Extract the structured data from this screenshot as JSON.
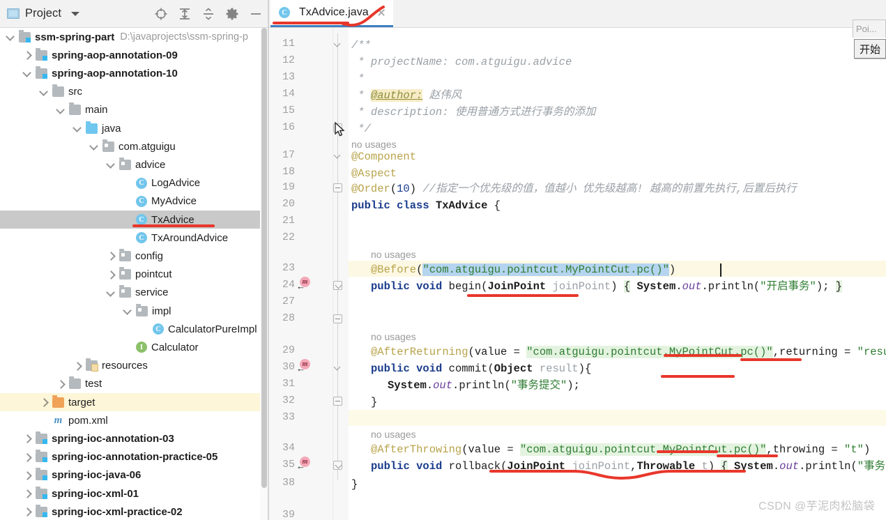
{
  "project_panel": {
    "title": "Project",
    "dropdown_icon": "chevron-down-icon",
    "toolbar_icons": [
      "locate-target-icon",
      "expand-all-icon",
      "collapse-all-icon",
      "settings-gear-icon",
      "minimize-icon"
    ],
    "tree": [
      {
        "label": "ssm-spring-part",
        "path": "D:\\javaprojects\\ssm-spring-p",
        "indent": 0,
        "arrow": "down",
        "icon": "module-folder",
        "bold": true
      },
      {
        "label": "spring-aop-annotation-09",
        "path": "",
        "indent": 1,
        "arrow": "right",
        "icon": "module-folder",
        "bold": true
      },
      {
        "label": "spring-aop-annotation-10",
        "path": "",
        "indent": 1,
        "arrow": "down",
        "icon": "module-folder",
        "bold": true
      },
      {
        "label": "src",
        "path": "",
        "indent": 2,
        "arrow": "down",
        "icon": "folder",
        "bold": false
      },
      {
        "label": "main",
        "path": "",
        "indent": 3,
        "arrow": "down",
        "icon": "folder",
        "bold": false
      },
      {
        "label": "java",
        "path": "",
        "indent": 4,
        "arrow": "down",
        "icon": "source-folder",
        "bold": false
      },
      {
        "label": "com.atguigu",
        "path": "",
        "indent": 5,
        "arrow": "down",
        "icon": "package",
        "bold": false
      },
      {
        "label": "advice",
        "path": "",
        "indent": 6,
        "arrow": "down",
        "icon": "package",
        "bold": false
      },
      {
        "label": "LogAdvice",
        "path": "",
        "indent": 7,
        "arrow": "none",
        "icon": "java-class",
        "bold": false
      },
      {
        "label": "MyAdvice",
        "path": "",
        "indent": 7,
        "arrow": "none",
        "icon": "java-class",
        "bold": false
      },
      {
        "label": "TxAdvice",
        "path": "",
        "indent": 7,
        "arrow": "none",
        "icon": "java-class",
        "bold": false,
        "selected": true
      },
      {
        "label": "TxAroundAdvice",
        "path": "",
        "indent": 7,
        "arrow": "none",
        "icon": "java-class",
        "bold": false
      },
      {
        "label": "config",
        "path": "",
        "indent": 6,
        "arrow": "right",
        "icon": "package",
        "bold": false
      },
      {
        "label": "pointcut",
        "path": "",
        "indent": 6,
        "arrow": "right",
        "icon": "package",
        "bold": false
      },
      {
        "label": "service",
        "path": "",
        "indent": 6,
        "arrow": "down",
        "icon": "package",
        "bold": false
      },
      {
        "label": "impl",
        "path": "",
        "indent": 7,
        "arrow": "down",
        "icon": "package",
        "bold": false
      },
      {
        "label": "CalculatorPureImpl",
        "path": "",
        "indent": 8,
        "arrow": "none",
        "icon": "java-class",
        "bold": false
      },
      {
        "label": "Calculator",
        "path": "",
        "indent": 7,
        "arrow": "none",
        "icon": "java-interface",
        "bold": false
      },
      {
        "label": "resources",
        "path": "",
        "indent": 4,
        "arrow": "right",
        "icon": "resources-folder",
        "bold": false
      },
      {
        "label": "test",
        "path": "",
        "indent": 3,
        "arrow": "right",
        "icon": "folder",
        "bold": false
      },
      {
        "label": "target",
        "path": "",
        "indent": 2,
        "arrow": "right",
        "icon": "excluded-folder",
        "bold": false,
        "highlight": true
      },
      {
        "label": "pom.xml",
        "path": "",
        "indent": 2,
        "arrow": "none",
        "icon": "maven-file",
        "bold": false
      },
      {
        "label": "spring-ioc-annotation-03",
        "path": "",
        "indent": 1,
        "arrow": "right",
        "icon": "module-folder",
        "bold": true
      },
      {
        "label": "spring-ioc-annotation-practice-05",
        "path": "",
        "indent": 1,
        "arrow": "right",
        "icon": "module-folder",
        "bold": true
      },
      {
        "label": "spring-ioc-java-06",
        "path": "",
        "indent": 1,
        "arrow": "right",
        "icon": "module-folder",
        "bold": true
      },
      {
        "label": "spring-ioc-xml-01",
        "path": "",
        "indent": 1,
        "arrow": "right",
        "icon": "module-folder",
        "bold": true
      },
      {
        "label": "spring-ioc-xml-practice-02",
        "path": "",
        "indent": 1,
        "arrow": "right",
        "icon": "module-folder",
        "bold": true
      }
    ]
  },
  "editor": {
    "tab": {
      "label": "TxAdvice.java",
      "icon": "java-class-icon",
      "close_icon": "close-icon"
    },
    "line_numbers": [
      "11",
      "12",
      "13",
      "14",
      "15",
      "16",
      "17",
      "18",
      "19",
      "20",
      "21",
      "22",
      "23",
      "24",
      "27",
      "28",
      "29",
      "30",
      "31",
      "32",
      "33",
      "34",
      "35",
      "38",
      "39"
    ],
    "gutter_marks": [
      "advice-method-marker",
      "advice-method-marker",
      "advice-method-marker"
    ],
    "inlay_no_usages": "no usages",
    "code": {
      "l11": "/**",
      "l12_pre": " * projectName: ",
      "l12_val": "com.atguigu.advice",
      "l13": " *",
      "l14_pre": " * ",
      "l14_tag": "@author:",
      "l14_val": " 赵伟风",
      "l15": " * description: 使用普通方式进行事务的添加",
      "l16": " */",
      "l17": "@Component",
      "l18": "@Aspect",
      "l19_anno": "@Order",
      "l19_num": "10",
      "l19_comment": "//指定一个优先级的值，值越小 优先级越高! 越高的前置先执行,后置后执行",
      "l20": "public class TxAdvice {",
      "l23_anno": "@Before",
      "l23_str": "\"com.atguigu.pointcut.MyPointCut.pc()\"",
      "l24": "public void begin(JoinPoint joinPoint) { System.out.println(\"开启事务\"); }",
      "l29_anno": "@AfterReturning",
      "l29_rest": "(value = \"com.atguigu.pointcut.MyPointCut.pc()\",returning = \"result\")",
      "l30": "public void commit(Object result){",
      "l31": "System.out.println(\"事务提交\");",
      "l32": "}",
      "l34_anno": "@AfterThrowing",
      "l34_rest": "(value = \"com.atguigu.pointcut.MyPointCut.pc()\",throwing = \"t\")",
      "l35": "public void rollback(JoinPoint joinPoint,Throwable t) { System.out.println(\"事务回滚\"); }",
      "l38": "}"
    }
  },
  "overlay": {
    "title": "Poi...",
    "button_label": "开始"
  },
  "watermark": "CSDN @芋泥肉松脑袋",
  "colors": {
    "accent": "#3d7fc1",
    "annotation_red": "#e8372b",
    "selection_blue": "#b5d4f0",
    "string_green": "#2e7d32",
    "keyword_blue": "#1a3c8c",
    "annotation_olive": "#b8a34a"
  }
}
